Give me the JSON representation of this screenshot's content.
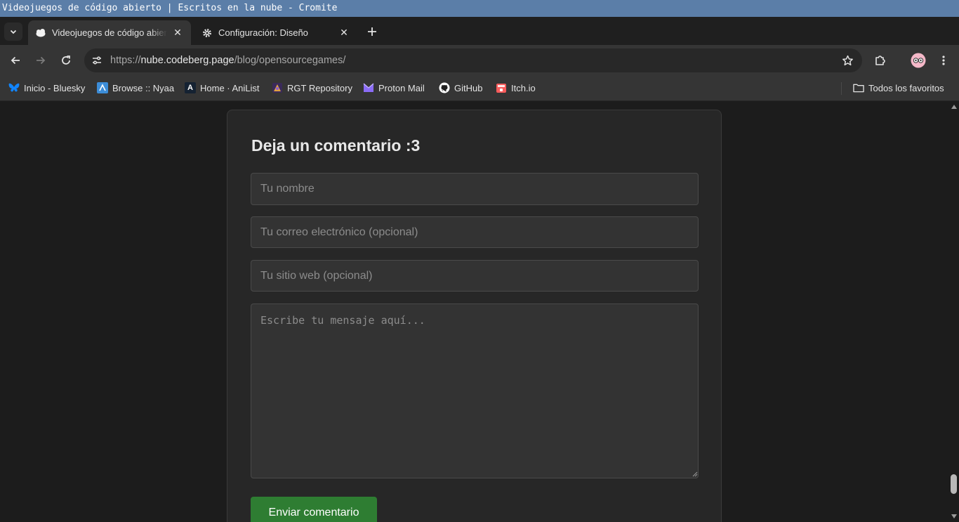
{
  "window": {
    "title": "Videojuegos de código abierto | Escritos en la nube - Cromite"
  },
  "tabs": [
    {
      "label": "Videojuegos de código abierto | Escritos en la nube",
      "icon": "site-favicon",
      "active": true
    },
    {
      "label": "Configuración: Diseño",
      "icon": "gear-icon",
      "active": false
    }
  ],
  "omnibox": {
    "scheme": "https://",
    "host": "nube.codeberg.page",
    "path": "/blog/opensourcegames/"
  },
  "bookmarks": [
    {
      "label": "Inicio - Bluesky",
      "icon": "bluesky-icon",
      "color": "#1185fe"
    },
    {
      "label": "Browse :: Nyaa",
      "icon": "nyaa-icon",
      "color": "#3c8dd8"
    },
    {
      "label": "Home · AniList",
      "icon": "anilist-icon",
      "color": "#02a9ff"
    },
    {
      "label": "RGT Repository",
      "icon": "rgt-icon",
      "color": "#8a5bd6"
    },
    {
      "label": "Proton Mail",
      "icon": "proton-icon",
      "color": "#8b6cf6"
    },
    {
      "label": "GitHub",
      "icon": "github-icon",
      "color": "#ffffff"
    },
    {
      "label": "Itch.io",
      "icon": "itch-icon",
      "color": "#fa5c5c"
    }
  ],
  "all_bookmarks": {
    "label": "Todos los favoritos"
  },
  "comment_form": {
    "heading": "Deja un comentario :3",
    "name_placeholder": "Tu nombre",
    "email_placeholder": "Tu correo electrónico (opcional)",
    "website_placeholder": "Tu sitio web (opcional)",
    "message_placeholder": "Escribe tu mensaje aquí...",
    "submit_label": "Enviar comentario",
    "submit_color": "#2e7d32"
  }
}
